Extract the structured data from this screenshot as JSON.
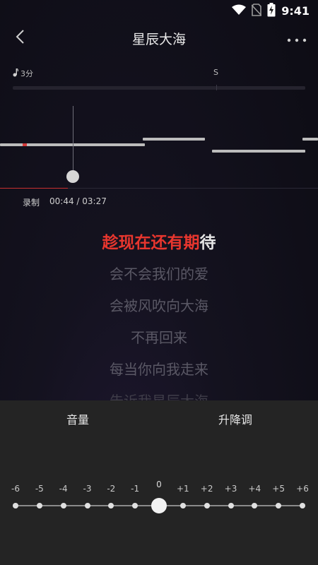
{
  "status_bar": {
    "time": "9:41",
    "icons": [
      "wifi-icon",
      "no-sim-icon",
      "battery-charging-icon"
    ]
  },
  "header": {
    "title": "星辰大海",
    "back_icon": "chevron-left-icon",
    "more_icon": "more-horizontal-icon"
  },
  "score": {
    "label": "3分",
    "grade": "S"
  },
  "playback": {
    "record_label": "录制",
    "time": "00:44 / 03:27"
  },
  "lyrics": {
    "current_sung": "趁现在还有期",
    "current_unsung": "待",
    "upcoming": [
      "会不会我们的爱",
      "会被风吹向大海",
      "不再回来",
      "每当你向我走来",
      "告诉我星辰大海"
    ]
  },
  "panel": {
    "tab_volume": "音量",
    "tab_pitch": "升降调",
    "pitch_labels": [
      "-6",
      "-5",
      "-4",
      "-3",
      "-2",
      "-1",
      "0",
      "+1",
      "+2",
      "+3",
      "+4",
      "+5",
      "+6"
    ],
    "pitch_value": "0"
  },
  "colors": {
    "accent": "#e8362e",
    "panel_bg": "#242424"
  }
}
